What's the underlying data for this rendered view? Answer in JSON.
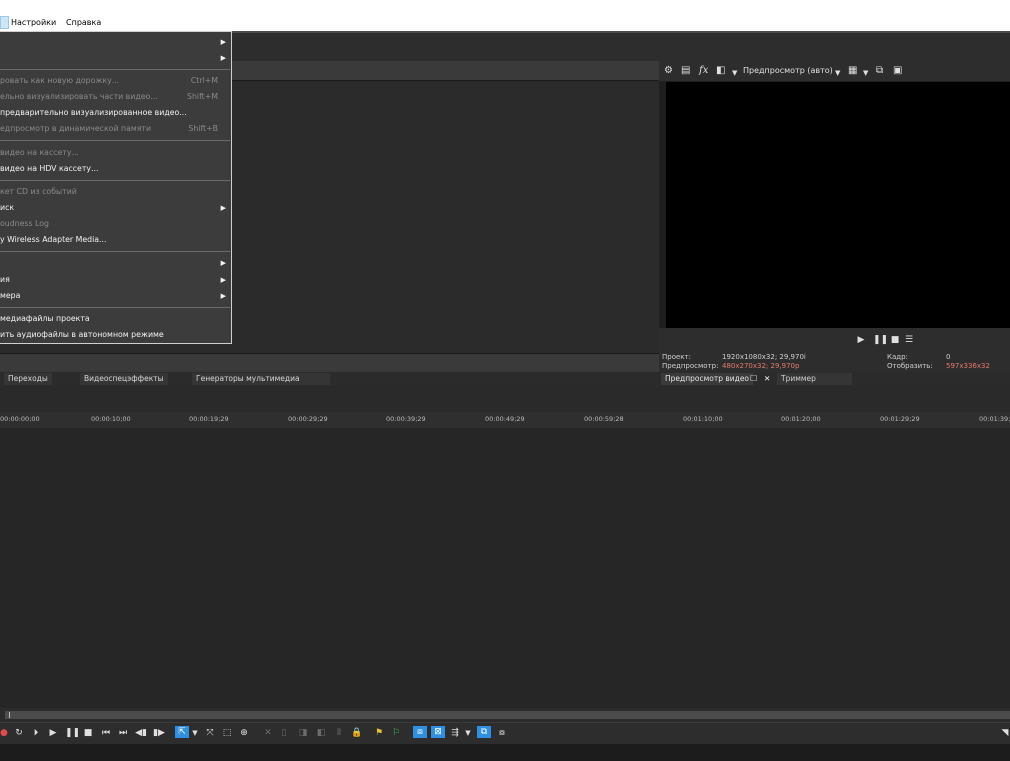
{
  "menubar": {
    "items": [
      "Настройки",
      "Справка"
    ]
  },
  "dropdown": {
    "items": [
      {
        "label": "",
        "shortcut": "",
        "submenu": true,
        "enabled": true
      },
      {
        "label": "",
        "shortcut": "",
        "submenu": true,
        "enabled": true
      },
      {
        "label": "ровать как новую дорожку...",
        "shortcut": "Ctrl+M",
        "submenu": false,
        "enabled": false
      },
      {
        "label": "ельно визуализировать части видео...",
        "shortcut": "Shift+M",
        "submenu": false,
        "enabled": false
      },
      {
        "label": " предварительно визуализированное видео...",
        "shortcut": "",
        "submenu": false,
        "enabled": true
      },
      {
        "label": "едпросмотр в динамической памяти",
        "shortcut": "Shift+B",
        "submenu": false,
        "enabled": false
      },
      {
        "label": " видео на кассету...",
        "shortcut": "",
        "submenu": false,
        "enabled": false
      },
      {
        "label": " видео на HDV кассету...",
        "shortcut": "",
        "submenu": false,
        "enabled": true
      },
      {
        "label": "кет CD из событий",
        "shortcut": "",
        "submenu": false,
        "enabled": false
      },
      {
        "label": "иск",
        "shortcut": "",
        "submenu": true,
        "enabled": true
      },
      {
        "label": "oudness Log",
        "shortcut": "",
        "submenu": false,
        "enabled": false
      },
      {
        "label": "y Wireless Adapter Media...",
        "shortcut": "",
        "submenu": false,
        "enabled": true
      },
      {
        "label": "",
        "shortcut": "",
        "submenu": true,
        "enabled": true
      },
      {
        "label": "ия",
        "shortcut": "",
        "submenu": true,
        "enabled": true
      },
      {
        "label": "мера",
        "shortcut": "",
        "submenu": true,
        "enabled": true
      },
      {
        "label": "медиафайлы проекта",
        "shortcut": "",
        "submenu": false,
        "enabled": true
      },
      {
        "label": "ить аудиофайлы в автономном режиме",
        "shortcut": "",
        "submenu": false,
        "enabled": true
      }
    ]
  },
  "left_tabs": [
    "Переходы",
    "Видеоспецэффекты",
    "Генераторы мультимедиа"
  ],
  "preview": {
    "mode_label": "Предпросмотр (авто)",
    "project_label": "Проект:",
    "project_value": "1920x1080x32; 29,970i",
    "preview_label": "Предпросмотр:",
    "preview_value": "480x270x32; 29,970p",
    "frame_label": "Кадр:",
    "frame_value": "0",
    "display_label": "Отобразить:",
    "display_value": "597x336x32",
    "tab_preview": "Предпросмотр видео",
    "tab_close": "✕",
    "tab_trimmer": "Триммер",
    "accent_color": "#e57b6a"
  },
  "ruler": {
    "ticks": [
      "00:00:00;00",
      "00:00:10;00",
      "00:00:19;29",
      "00:00:29;29",
      "00:00:39;29",
      "00:00:49;29",
      "00:00:59;28",
      "00:01:10;00",
      "00:01:20;00",
      "00:01:29;29",
      "00:01:39;2"
    ]
  }
}
